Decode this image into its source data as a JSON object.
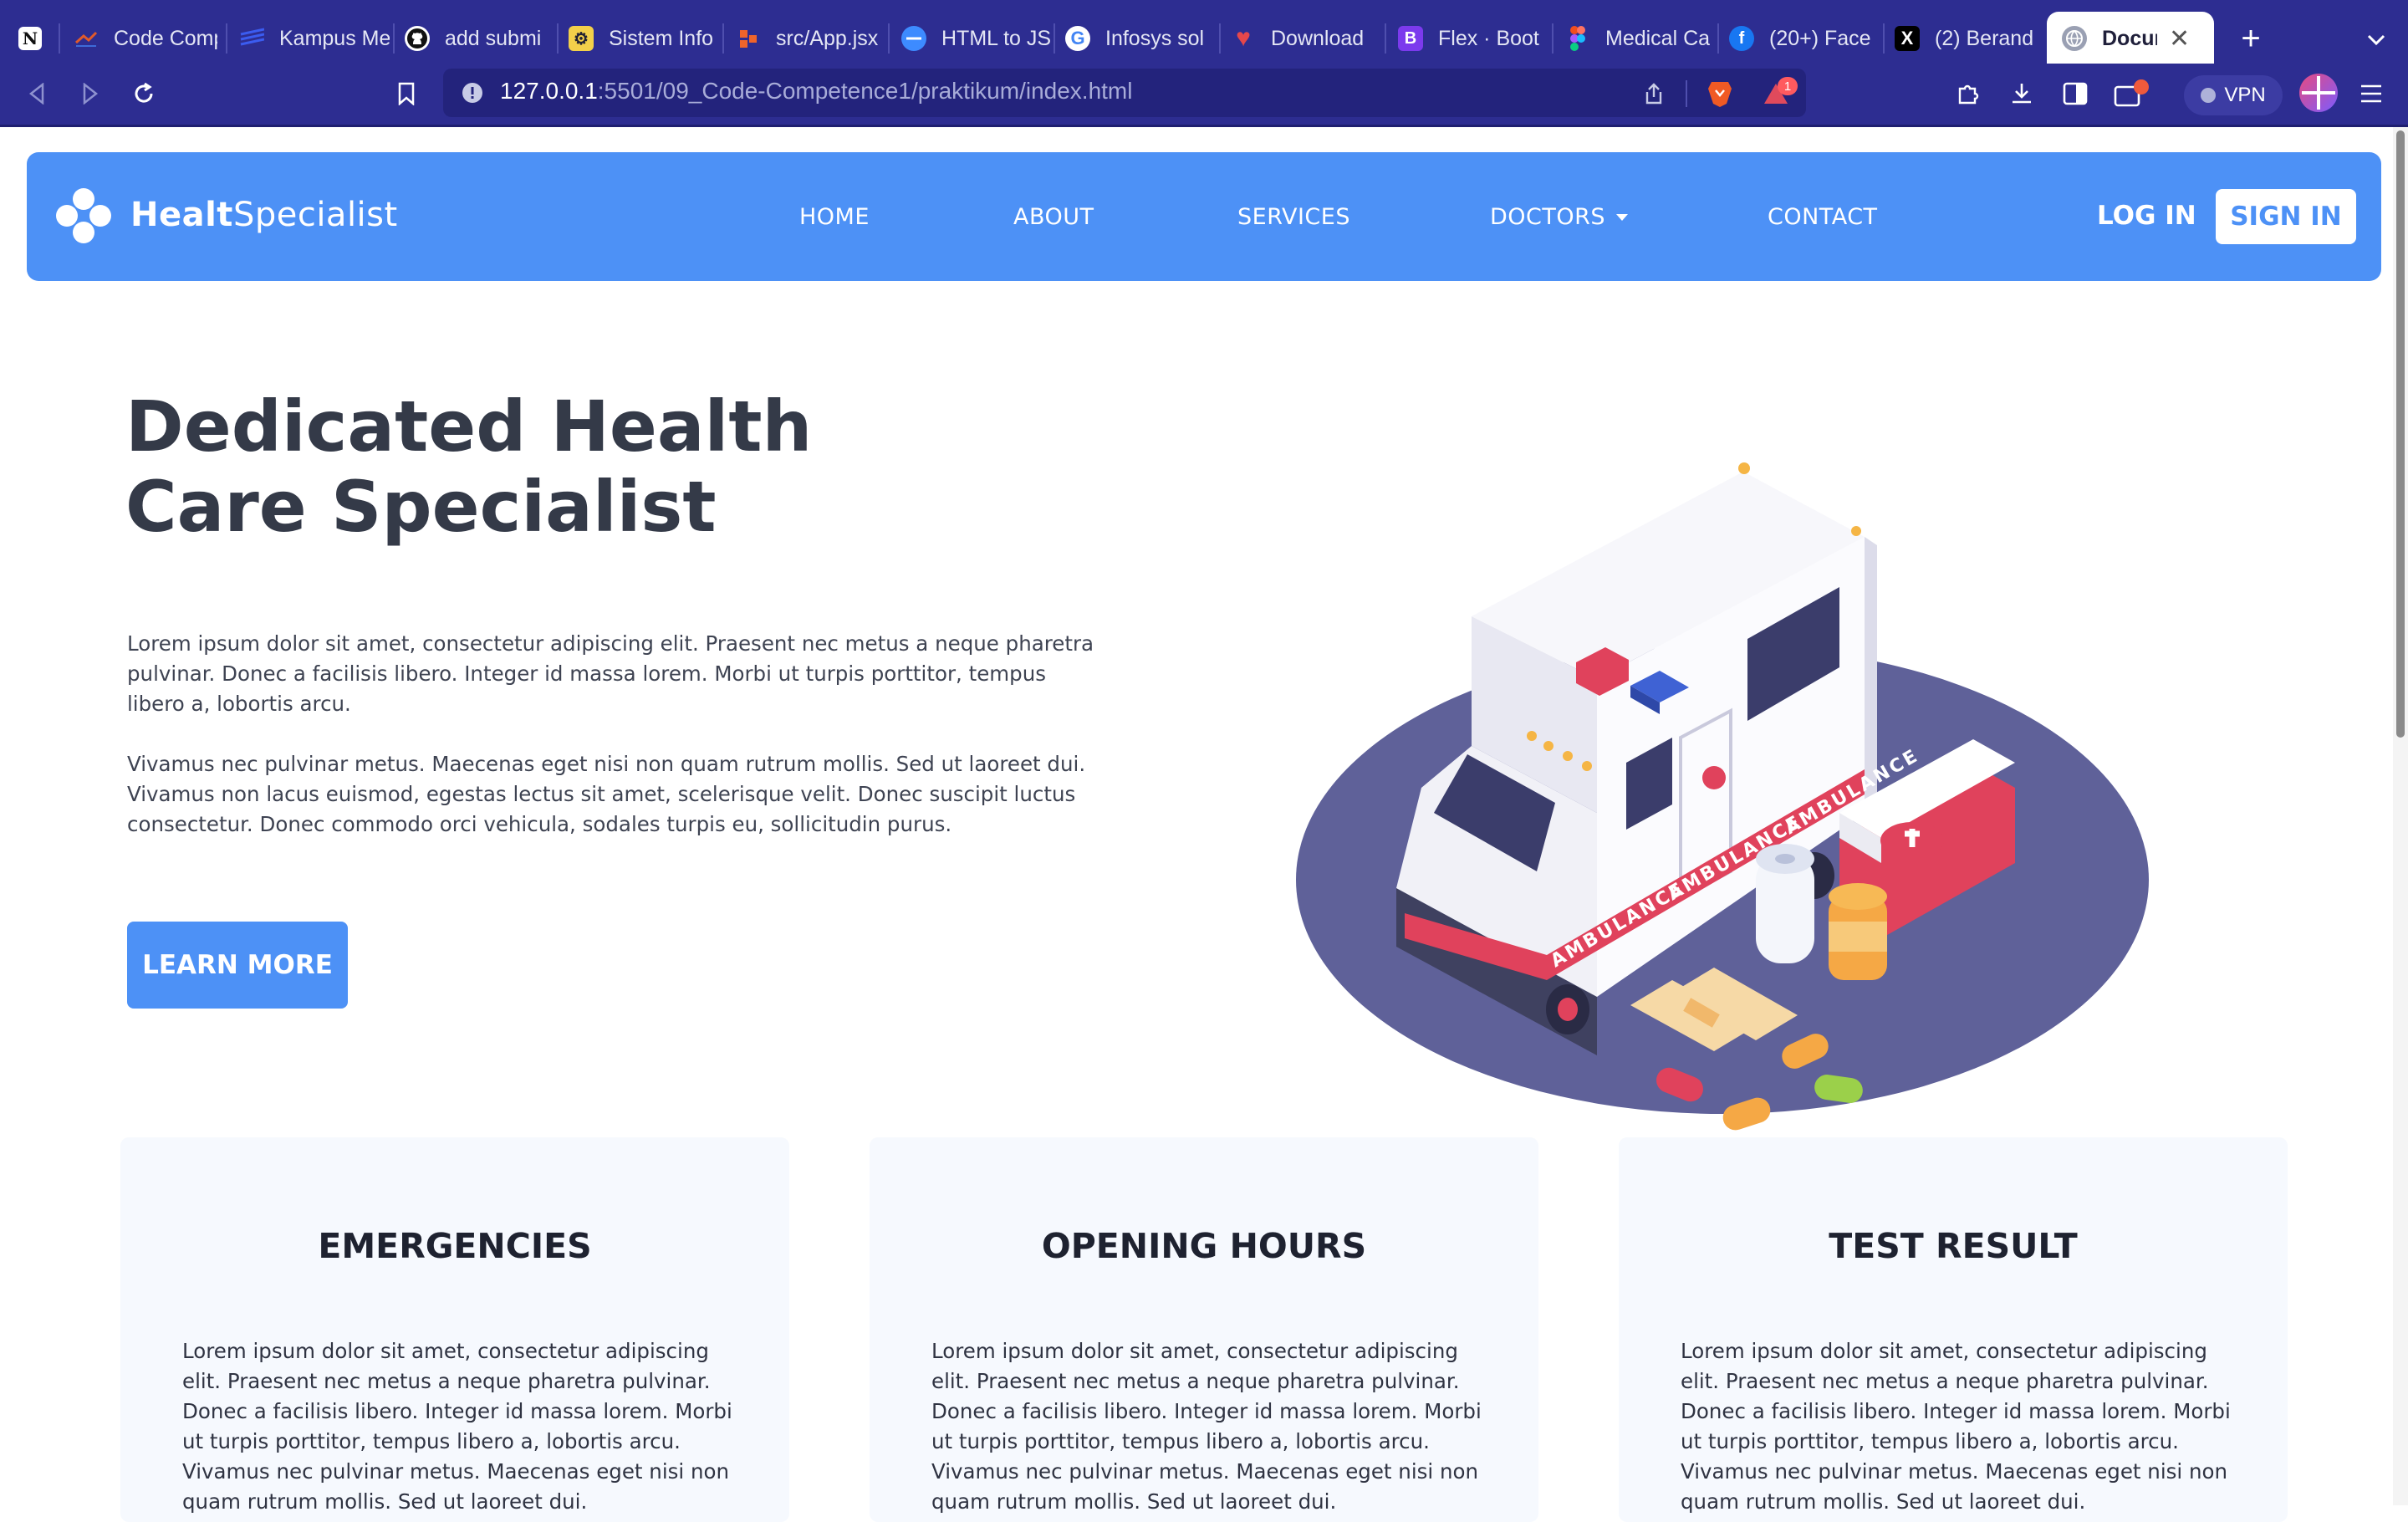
{
  "browser": {
    "tabs": [
      {
        "title": "",
        "icon": "notion-icon",
        "color": "#111111"
      },
      {
        "title": "Code Comp",
        "icon": "code-competence-icon",
        "color": "#e05a2b"
      },
      {
        "title": "Kampus Me",
        "icon": "kampus-merdeka-icon",
        "color": "#2f4fd8"
      },
      {
        "title": "add submi",
        "icon": "github-icon",
        "color": "#111111"
      },
      {
        "title": "Sistem Info",
        "icon": "university-icon",
        "color": "#f0c428"
      },
      {
        "title": "src/App.jsx",
        "icon": "gitlab-icon",
        "color": "#f0642a"
      },
      {
        "title": "HTML to JS",
        "icon": "converter-icon",
        "color": "#3d8bff"
      },
      {
        "title": "Infosys sol",
        "icon": "google-icon",
        "color": "#ffffff"
      },
      {
        "title": "Download",
        "icon": "heart-icon",
        "color": "#e5474b"
      },
      {
        "title": "Flex · Boot",
        "icon": "bootstrap-icon",
        "color": "#7c3aed"
      },
      {
        "title": "Medical Ca",
        "icon": "figma-icon",
        "color": "#f24e1e"
      },
      {
        "title": "(20+) Face",
        "icon": "facebook-icon",
        "color": "#1877f2"
      },
      {
        "title": "(2) Berand",
        "icon": "x-icon",
        "color": "#111111"
      },
      {
        "title": "Docum",
        "icon": "globe-icon",
        "color": "#8a8a9a",
        "active": true
      }
    ],
    "url_host": "127.0.0.1",
    "url_path": ":5501/09_Code-Competence1/praktikum/index.html",
    "notification_badge": "1",
    "vpn_label": "VPN"
  },
  "nav": {
    "brand_bold": "Healt",
    "brand_rest": "Specialist",
    "links": [
      "HOME",
      "ABOUT",
      "SERVICES",
      "DOCTORS",
      "CONTACT"
    ],
    "login": "LOG IN",
    "signin": "SIGN IN"
  },
  "hero": {
    "title_line1": "Dedicated Health",
    "title_line2": "Care Specialist",
    "para1": "Lorem ipsum dolor sit amet, consectetur adipiscing elit. Praesent nec metus a neque pharetra pulvinar. Donec a facilisis libero. Integer id massa lorem. Morbi ut turpis porttitor, tempus libero a, lobortis arcu.",
    "para2": "Vivamus nec pulvinar metus. Maecenas eget nisi non quam rutrum mollis. Sed ut laoreet dui. Vivamus non lacus euismod, egestas lectus sit amet, scelerisque velit. Donec suscipit luctus consectetur. Donec commodo orci vehicula, sodales turpis eu, sollicitudin purus.",
    "button": "LEARN MORE",
    "ambulance_text": "AMBULANCE"
  },
  "cards": [
    {
      "title": "EMERGENCIES",
      "text": "Lorem ipsum dolor sit amet, consectetur adipiscing elit. Praesent nec metus a neque pharetra pulvinar. Donec a facilisis libero. Integer id massa lorem. Morbi ut turpis porttitor, tempus libero a, lobortis arcu. Vivamus nec pulvinar metus. Maecenas eget nisi non quam rutrum mollis. Sed ut laoreet dui."
    },
    {
      "title": "OPENING HOURS",
      "text": "Lorem ipsum dolor sit amet, consectetur adipiscing elit. Praesent nec metus a neque pharetra pulvinar. Donec a facilisis libero. Integer id massa lorem. Morbi ut turpis porttitor, tempus libero a, lobortis arcu. Vivamus nec pulvinar metus. Maecenas eget nisi non quam rutrum mollis. Sed ut laoreet dui."
    },
    {
      "title": "TEST RESULT",
      "text": "Lorem ipsum dolor sit amet, consectetur adipiscing elit. Praesent nec metus a neque pharetra pulvinar. Donec a facilisis libero. Integer id massa lorem. Morbi ut turpis porttitor, tempus libero a, lobortis arcu. Vivamus nec pulvinar metus. Maecenas eget nisi non quam rutrum mollis. Sed ut laoreet dui."
    }
  ],
  "colors": {
    "brand": "#4d91f6",
    "browser_chrome": "#2d2d91",
    "heading": "#343a48",
    "plate": "#5f6199"
  }
}
